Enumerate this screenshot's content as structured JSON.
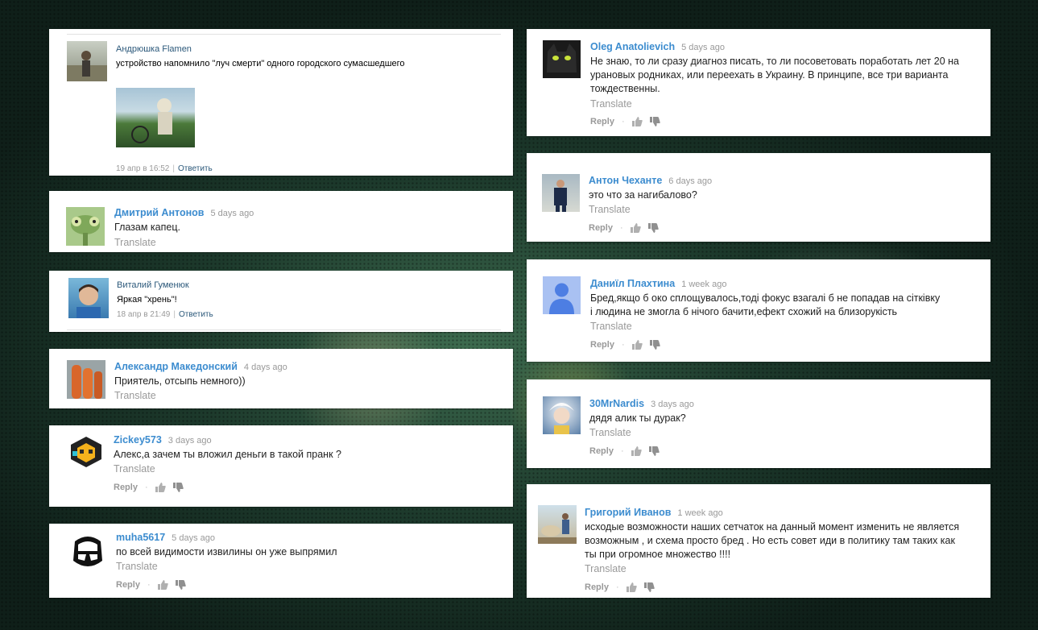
{
  "left_column": {
    "c1": {
      "name": "Андрюшка Flamen",
      "text": "устройство напомнило \"луч смерти\" одного городского сумасшедшего",
      "date": "19 апр в 16:52",
      "reply": "Ответить"
    },
    "c2": {
      "name": "Дмитрий Антонов",
      "date": "5 days ago",
      "text": "Глазам капец.",
      "translate": "Translate"
    },
    "c3": {
      "name": "Виталий Гуменюк",
      "text": "Яркая \"хрень\"!",
      "date": "18 апр в 21:49",
      "reply": "Ответить"
    },
    "c4": {
      "name": "Александр Македонский",
      "date": "4 days ago",
      "text": "Приятель, отсыпь немного))",
      "translate": "Translate"
    },
    "c5": {
      "name": "Zickey573",
      "date": "3 days ago",
      "text": "Алекс,а зачем ты вложил деньги в такой пранк ?",
      "translate": "Translate",
      "reply": "Reply"
    },
    "c6": {
      "name": "muha5617",
      "date": "5 days ago",
      "text": "по всей видимости извилины он уже выпрямил",
      "translate": "Translate",
      "reply": "Reply"
    }
  },
  "right_column": {
    "c1": {
      "name": "Oleg Anatolievich",
      "date": "5 days ago",
      "lines": [
        "Не знаю, то ли сразу диагноз писать, то ли посоветовать поработать лет 20 на",
        "урановых родниках, или переехать в Украину. В принципе, все три варианта",
        "тождественны."
      ],
      "translate": "Translate",
      "reply": "Reply"
    },
    "c2": {
      "name": "Антон Чеханте",
      "date": "6 days ago",
      "lines": [
        "это что за нагибалово?"
      ],
      "translate": "Translate",
      "reply": "Reply"
    },
    "c3": {
      "name": "Даниїл Плахтина",
      "date": "1 week ago",
      "lines": [
        "Бред,якщо б око сплощувалось,тоді фокус взагалі б не попадав на сітківку",
        "і людина не змогла б нічого бачити,ефект схожий на близорукість"
      ],
      "translate": "Translate",
      "reply": "Reply"
    },
    "c4": {
      "name": "30MrNardis",
      "date": "3 days ago",
      "lines": [
        "дядя алик ты дурак?"
      ],
      "translate": "Translate",
      "reply": "Reply"
    },
    "c5": {
      "name": "Григорий Иванов",
      "date": "1 week ago",
      "lines": [
        "исходые возможности наших сетчаток на данный момент изменить не является",
        "возможным , и схема просто бред . Но есть совет иди в политику там таких как",
        "ты при огромное множество !!!!"
      ],
      "translate": "Translate",
      "reply": "Reply"
    }
  },
  "icons": {
    "thumb_up": "thumb-up-icon",
    "thumb_down": "thumb-down-icon"
  },
  "colors": {
    "vk_link": "#2b587a",
    "yt_name": "#3c8ccf",
    "muted": "#999999"
  }
}
